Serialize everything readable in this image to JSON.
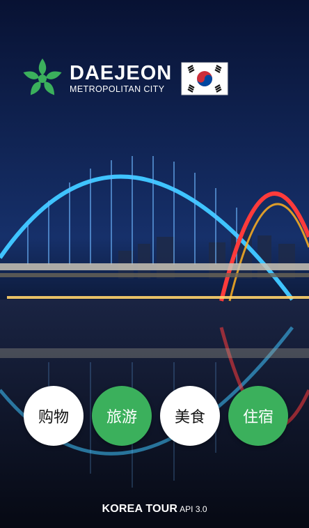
{
  "brand": {
    "title": "DAEJEON",
    "subtitle": "METROPOLITAN CITY"
  },
  "colors": {
    "logo_green": "#3bb05c",
    "button_green": "#3bb05c",
    "button_white": "#ffffff"
  },
  "icons": {
    "logo": "daejeon-star-logo-icon",
    "flag": "korea-flag-icon"
  },
  "categories": [
    {
      "label": "购物",
      "style": "white"
    },
    {
      "label": "旅游",
      "style": "green"
    },
    {
      "label": "美食",
      "style": "white"
    },
    {
      "label": "住宿",
      "style": "green"
    }
  ],
  "footer": {
    "title": "KOREA TOUR",
    "version": "API 3.0"
  }
}
